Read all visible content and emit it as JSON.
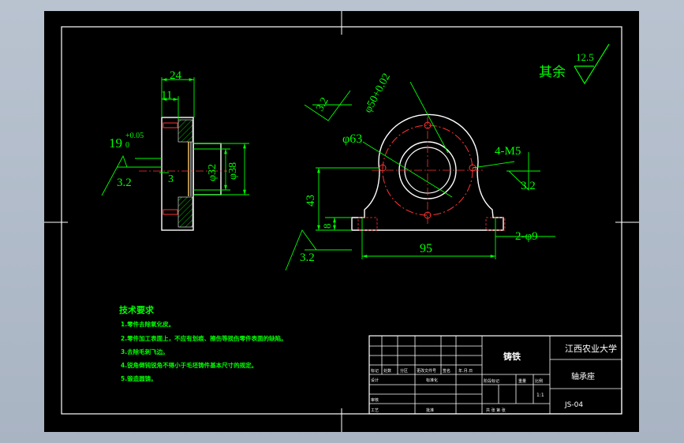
{
  "drawing": {
    "finish_note": {
      "label": "其余",
      "roughness": "12.5"
    },
    "side_view": {
      "dim_width": "24",
      "dim_flange": "11",
      "tolerance_base": "19",
      "tolerance_upper": "+0.05",
      "tolerance_lower": "0",
      "roughness_left": "3.2",
      "dim_small": "3",
      "dim_bore": "φ32",
      "dim_outer": "φ38"
    },
    "front_view": {
      "dim_fit": "φ50+0.02",
      "roughness_top": "3.2",
      "dim_circle": "φ63",
      "dim_tapped": "4-M5",
      "roughness_right": "3.2",
      "dim_height": "43",
      "dim_base_thick": "8",
      "roughness_bottom": "3.2",
      "dim_length": "95",
      "dim_holes": "2-φ9"
    },
    "tech_requirements": {
      "title": "技术要求",
      "items": [
        "1.零件去除氧化皮。",
        "2.零件加工表面上，不应有划痕、擦伤等损伤零件表面的缺陷。",
        "3.去除毛刺飞边。",
        "4.锐角倒钝锐角不得小于毛坯铸件基本尺寸的规定。",
        "5.锻造圆铸。"
      ]
    },
    "title_block": {
      "material": "铸铁",
      "school": "江西农业大学",
      "part_name": "轴承座",
      "drawing_no": "JS-04",
      "scale": "1:1",
      "labels": {
        "mark": "标记",
        "count": "处数",
        "zone": "分区",
        "change_doc": "更改文件号",
        "sign": "签名",
        "date": "年.月.日",
        "design": "设计",
        "standard": "标准化",
        "stage_mark": "阶段标记",
        "weight": "重量",
        "ratio": "比例",
        "review": "审核",
        "process": "工艺",
        "approve": "批准",
        "sheets": "共 张 第 张"
      }
    }
  }
}
